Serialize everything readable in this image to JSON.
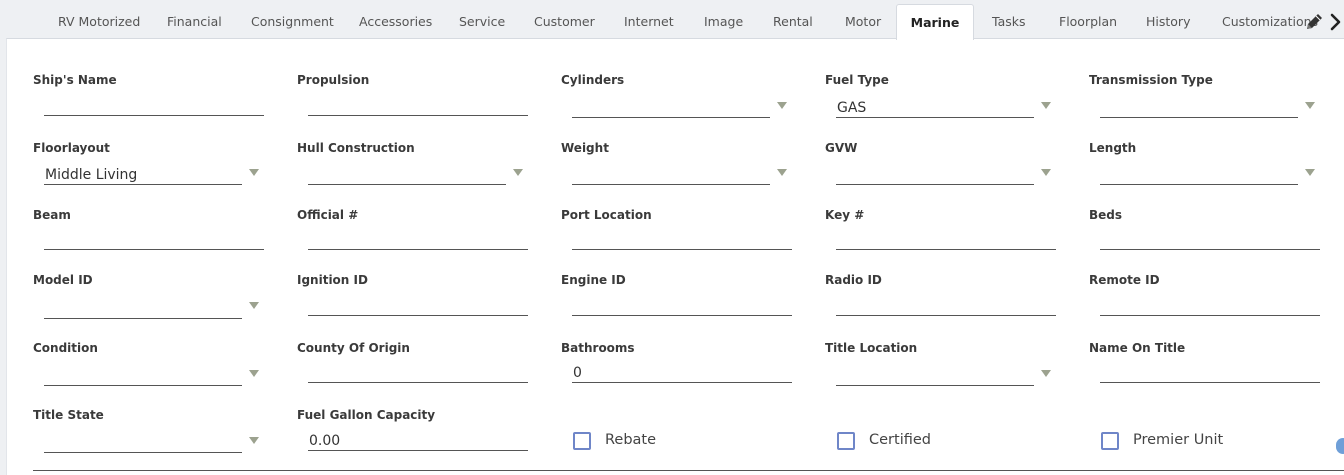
{
  "tabs": [
    {
      "label": "RV Motorized"
    },
    {
      "label": "Financial"
    },
    {
      "label": "Consignment"
    },
    {
      "label": "Accessories"
    },
    {
      "label": "Service"
    },
    {
      "label": "Customer"
    },
    {
      "label": "Internet"
    },
    {
      "label": "Image"
    },
    {
      "label": "Rental"
    },
    {
      "label": "Motor"
    },
    {
      "label": "Marine"
    },
    {
      "label": "Tasks"
    },
    {
      "label": "Floorplan"
    },
    {
      "label": "History"
    },
    {
      "label": "Customizations"
    }
  ],
  "active_tab": "Marine",
  "icons": {
    "edit": "pencil-icon",
    "next": "chevron-right-icon"
  },
  "fields": [
    {
      "label": "Ship's Name",
      "value": "",
      "type": "text"
    },
    {
      "label": "Propulsion",
      "value": "",
      "type": "text"
    },
    {
      "label": "Cylinders",
      "value": "",
      "type": "select"
    },
    {
      "label": "Fuel Type",
      "value": "GAS",
      "type": "select"
    },
    {
      "label": "Transmission Type",
      "value": "",
      "type": "select"
    },
    {
      "label": "Floorlayout",
      "value": "Middle Living",
      "type": "select"
    },
    {
      "label": "Hull Construction",
      "value": "",
      "type": "select"
    },
    {
      "label": "Weight",
      "value": "",
      "type": "select"
    },
    {
      "label": "GVW",
      "value": "",
      "type": "select"
    },
    {
      "label": "Length",
      "value": "",
      "type": "select"
    },
    {
      "label": "Beam",
      "value": "",
      "type": "text"
    },
    {
      "label": "Official #",
      "value": "",
      "type": "text"
    },
    {
      "label": "Port Location",
      "value": "",
      "type": "text"
    },
    {
      "label": "Key #",
      "value": "",
      "type": "text"
    },
    {
      "label": "Beds",
      "value": "",
      "type": "text"
    },
    {
      "label": "Model ID",
      "value": "",
      "type": "select"
    },
    {
      "label": "Ignition ID",
      "value": "",
      "type": "text"
    },
    {
      "label": "Engine ID",
      "value": "",
      "type": "text"
    },
    {
      "label": "Radio ID",
      "value": "",
      "type": "text"
    },
    {
      "label": "Remote ID",
      "value": "",
      "type": "text"
    },
    {
      "label": "Condition",
      "value": "",
      "type": "select"
    },
    {
      "label": "County Of Origin",
      "value": "",
      "type": "text"
    },
    {
      "label": "Bathrooms",
      "value": "0",
      "type": "text"
    },
    {
      "label": "Title Location",
      "value": "",
      "type": "select"
    },
    {
      "label": "Name On Title",
      "value": "",
      "type": "text"
    },
    {
      "label": "Title State",
      "value": "",
      "type": "select"
    },
    {
      "label": "Fuel Gallon Capacity",
      "value": "0.00",
      "type": "text"
    }
  ],
  "checkboxes": [
    {
      "label": "Rebate",
      "checked": false
    },
    {
      "label": "Certified",
      "checked": false
    },
    {
      "label": "Premier Unit",
      "checked": false
    }
  ],
  "colors": {
    "checkbox_border": "#6f86c8",
    "caret": "#9ca28f",
    "active_tab_bg": "#ffffff"
  }
}
